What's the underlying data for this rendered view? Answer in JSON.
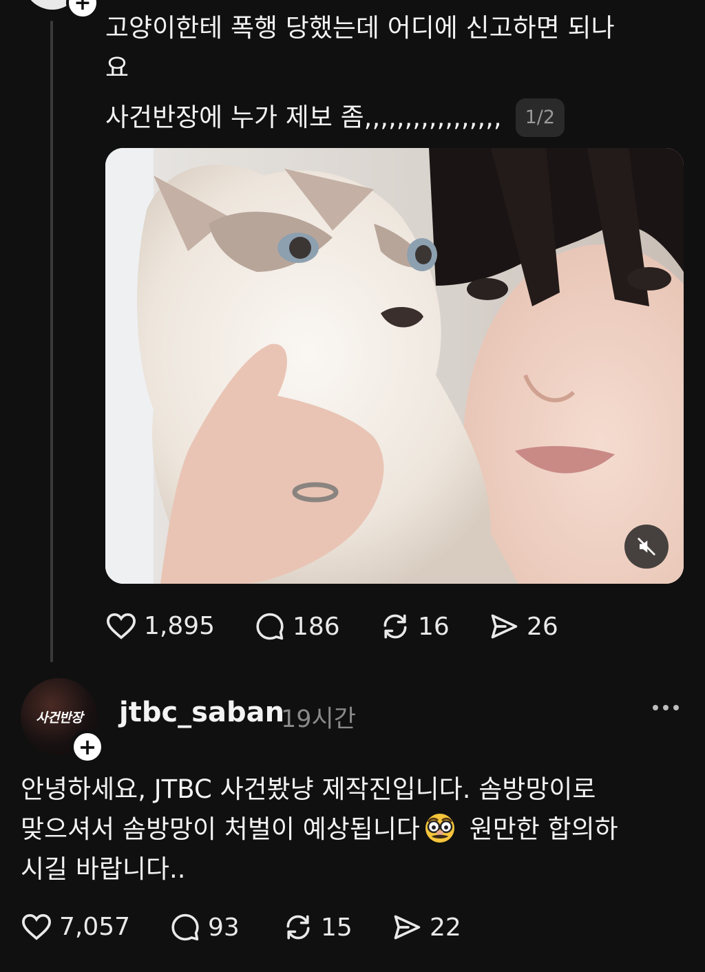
{
  "post1": {
    "text_lines": [
      "고양이한테 폭행 당했는데 어디에 신고하면 되나",
      "요",
      "사건반장에 누가 제보 좀,,,,,,,,,,,,,,,,,"
    ],
    "page_badge": "1/2",
    "actions": {
      "likes": "1,895",
      "comments": "186",
      "reposts": "16",
      "shares": "26"
    }
  },
  "post2": {
    "username": "jtbc_saban",
    "time": "19시간",
    "avatar_logo_text": "사건반장",
    "text_line1": "안녕하세요, JTBC 사건봤냥 제작진입니다. 솜방망이로",
    "text_line2_before_emoji": "맞으셔서 솜방망이 처벌이 예상됩니다",
    "text_line2_after_emoji": " 원만한 합의하",
    "text_line3": "시길 바랍니다..",
    "actions": {
      "likes": "7,057",
      "comments": "93",
      "reposts": "15",
      "shares": "22"
    }
  },
  "icons": {
    "heart": "heart-icon",
    "comment": "comment-icon",
    "repost": "repost-icon",
    "share": "share-icon",
    "mute": "volume-muted-icon",
    "more": "more-options-icon",
    "follow": "plus-icon",
    "emoji": "disguise-face-emoji"
  },
  "colors": {
    "background": "#101010",
    "text": "#f3f3f3",
    "muted_text": "#8a8a8a",
    "thread_line": "#3a3a3a"
  }
}
